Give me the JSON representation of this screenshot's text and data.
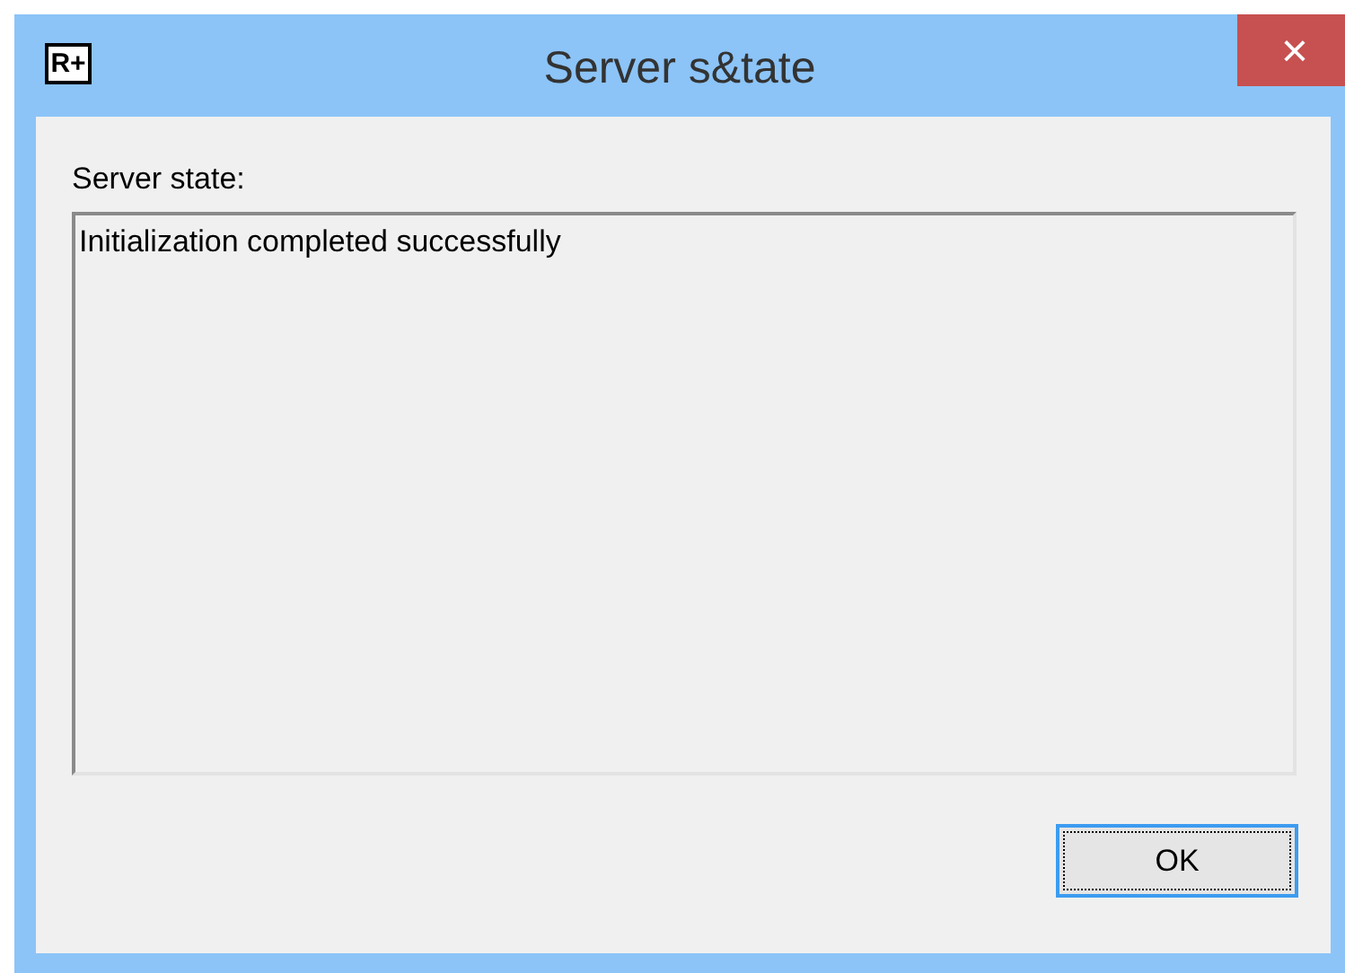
{
  "window": {
    "app_icon": "R+",
    "title": "Server s&tate",
    "close": "×"
  },
  "label": "Server state:",
  "state_box": {
    "value": "Initialization completed successfully"
  },
  "buttons": [
    {
      "label": "OK",
      "focused": true
    }
  ]
}
